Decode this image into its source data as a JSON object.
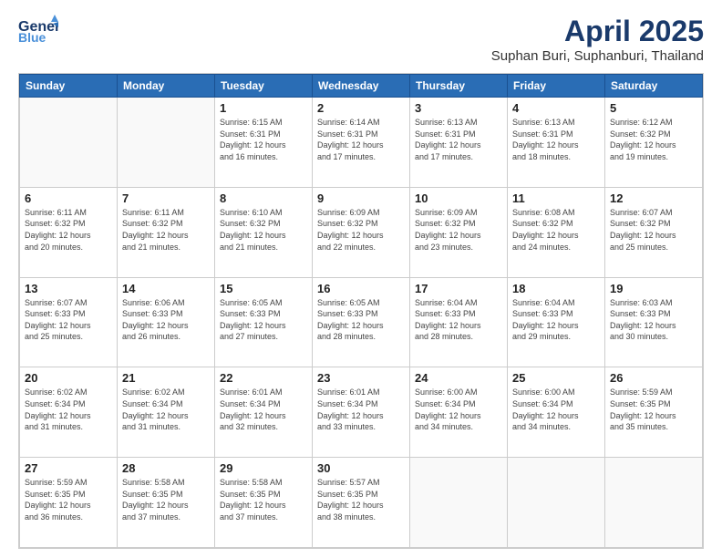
{
  "header": {
    "logo_line1": "General",
    "logo_line2": "Blue",
    "title": "April 2025",
    "subtitle": "Suphan Buri, Suphanburi, Thailand"
  },
  "days_of_week": [
    "Sunday",
    "Monday",
    "Tuesday",
    "Wednesday",
    "Thursday",
    "Friday",
    "Saturday"
  ],
  "weeks": [
    [
      {
        "day": "",
        "info": ""
      },
      {
        "day": "",
        "info": ""
      },
      {
        "day": "1",
        "info": "Sunrise: 6:15 AM\nSunset: 6:31 PM\nDaylight: 12 hours\nand 16 minutes."
      },
      {
        "day": "2",
        "info": "Sunrise: 6:14 AM\nSunset: 6:31 PM\nDaylight: 12 hours\nand 17 minutes."
      },
      {
        "day": "3",
        "info": "Sunrise: 6:13 AM\nSunset: 6:31 PM\nDaylight: 12 hours\nand 17 minutes."
      },
      {
        "day": "4",
        "info": "Sunrise: 6:13 AM\nSunset: 6:31 PM\nDaylight: 12 hours\nand 18 minutes."
      },
      {
        "day": "5",
        "info": "Sunrise: 6:12 AM\nSunset: 6:32 PM\nDaylight: 12 hours\nand 19 minutes."
      }
    ],
    [
      {
        "day": "6",
        "info": "Sunrise: 6:11 AM\nSunset: 6:32 PM\nDaylight: 12 hours\nand 20 minutes."
      },
      {
        "day": "7",
        "info": "Sunrise: 6:11 AM\nSunset: 6:32 PM\nDaylight: 12 hours\nand 21 minutes."
      },
      {
        "day": "8",
        "info": "Sunrise: 6:10 AM\nSunset: 6:32 PM\nDaylight: 12 hours\nand 21 minutes."
      },
      {
        "day": "9",
        "info": "Sunrise: 6:09 AM\nSunset: 6:32 PM\nDaylight: 12 hours\nand 22 minutes."
      },
      {
        "day": "10",
        "info": "Sunrise: 6:09 AM\nSunset: 6:32 PM\nDaylight: 12 hours\nand 23 minutes."
      },
      {
        "day": "11",
        "info": "Sunrise: 6:08 AM\nSunset: 6:32 PM\nDaylight: 12 hours\nand 24 minutes."
      },
      {
        "day": "12",
        "info": "Sunrise: 6:07 AM\nSunset: 6:32 PM\nDaylight: 12 hours\nand 25 minutes."
      }
    ],
    [
      {
        "day": "13",
        "info": "Sunrise: 6:07 AM\nSunset: 6:33 PM\nDaylight: 12 hours\nand 25 minutes."
      },
      {
        "day": "14",
        "info": "Sunrise: 6:06 AM\nSunset: 6:33 PM\nDaylight: 12 hours\nand 26 minutes."
      },
      {
        "day": "15",
        "info": "Sunrise: 6:05 AM\nSunset: 6:33 PM\nDaylight: 12 hours\nand 27 minutes."
      },
      {
        "day": "16",
        "info": "Sunrise: 6:05 AM\nSunset: 6:33 PM\nDaylight: 12 hours\nand 28 minutes."
      },
      {
        "day": "17",
        "info": "Sunrise: 6:04 AM\nSunset: 6:33 PM\nDaylight: 12 hours\nand 28 minutes."
      },
      {
        "day": "18",
        "info": "Sunrise: 6:04 AM\nSunset: 6:33 PM\nDaylight: 12 hours\nand 29 minutes."
      },
      {
        "day": "19",
        "info": "Sunrise: 6:03 AM\nSunset: 6:33 PM\nDaylight: 12 hours\nand 30 minutes."
      }
    ],
    [
      {
        "day": "20",
        "info": "Sunrise: 6:02 AM\nSunset: 6:34 PM\nDaylight: 12 hours\nand 31 minutes."
      },
      {
        "day": "21",
        "info": "Sunrise: 6:02 AM\nSunset: 6:34 PM\nDaylight: 12 hours\nand 31 minutes."
      },
      {
        "day": "22",
        "info": "Sunrise: 6:01 AM\nSunset: 6:34 PM\nDaylight: 12 hours\nand 32 minutes."
      },
      {
        "day": "23",
        "info": "Sunrise: 6:01 AM\nSunset: 6:34 PM\nDaylight: 12 hours\nand 33 minutes."
      },
      {
        "day": "24",
        "info": "Sunrise: 6:00 AM\nSunset: 6:34 PM\nDaylight: 12 hours\nand 34 minutes."
      },
      {
        "day": "25",
        "info": "Sunrise: 6:00 AM\nSunset: 6:34 PM\nDaylight: 12 hours\nand 34 minutes."
      },
      {
        "day": "26",
        "info": "Sunrise: 5:59 AM\nSunset: 6:35 PM\nDaylight: 12 hours\nand 35 minutes."
      }
    ],
    [
      {
        "day": "27",
        "info": "Sunrise: 5:59 AM\nSunset: 6:35 PM\nDaylight: 12 hours\nand 36 minutes."
      },
      {
        "day": "28",
        "info": "Sunrise: 5:58 AM\nSunset: 6:35 PM\nDaylight: 12 hours\nand 37 minutes."
      },
      {
        "day": "29",
        "info": "Sunrise: 5:58 AM\nSunset: 6:35 PM\nDaylight: 12 hours\nand 37 minutes."
      },
      {
        "day": "30",
        "info": "Sunrise: 5:57 AM\nSunset: 6:35 PM\nDaylight: 12 hours\nand 38 minutes."
      },
      {
        "day": "",
        "info": ""
      },
      {
        "day": "",
        "info": ""
      },
      {
        "day": "",
        "info": ""
      }
    ]
  ]
}
